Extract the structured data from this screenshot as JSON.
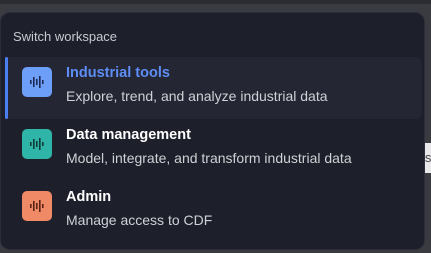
{
  "menu": {
    "header": "Switch workspace",
    "items": [
      {
        "title": "Industrial tools",
        "description": "Explore, trend, and analyze industrial data",
        "icon": "waveform-icon",
        "color": "#6d9ef8",
        "active": true
      },
      {
        "title": "Data management",
        "description": "Model, integrate, and transform industrial data",
        "icon": "waveform-icon",
        "color": "#2fb5a8",
        "active": false
      },
      {
        "title": "Admin",
        "description": "Manage access to CDF",
        "icon": "waveform-icon",
        "color": "#f08a66",
        "active": false
      }
    ]
  },
  "background": {
    "partial_text": "is"
  },
  "colors": {
    "accent": "#4c7ef3",
    "panel": "#1d1f2a"
  }
}
